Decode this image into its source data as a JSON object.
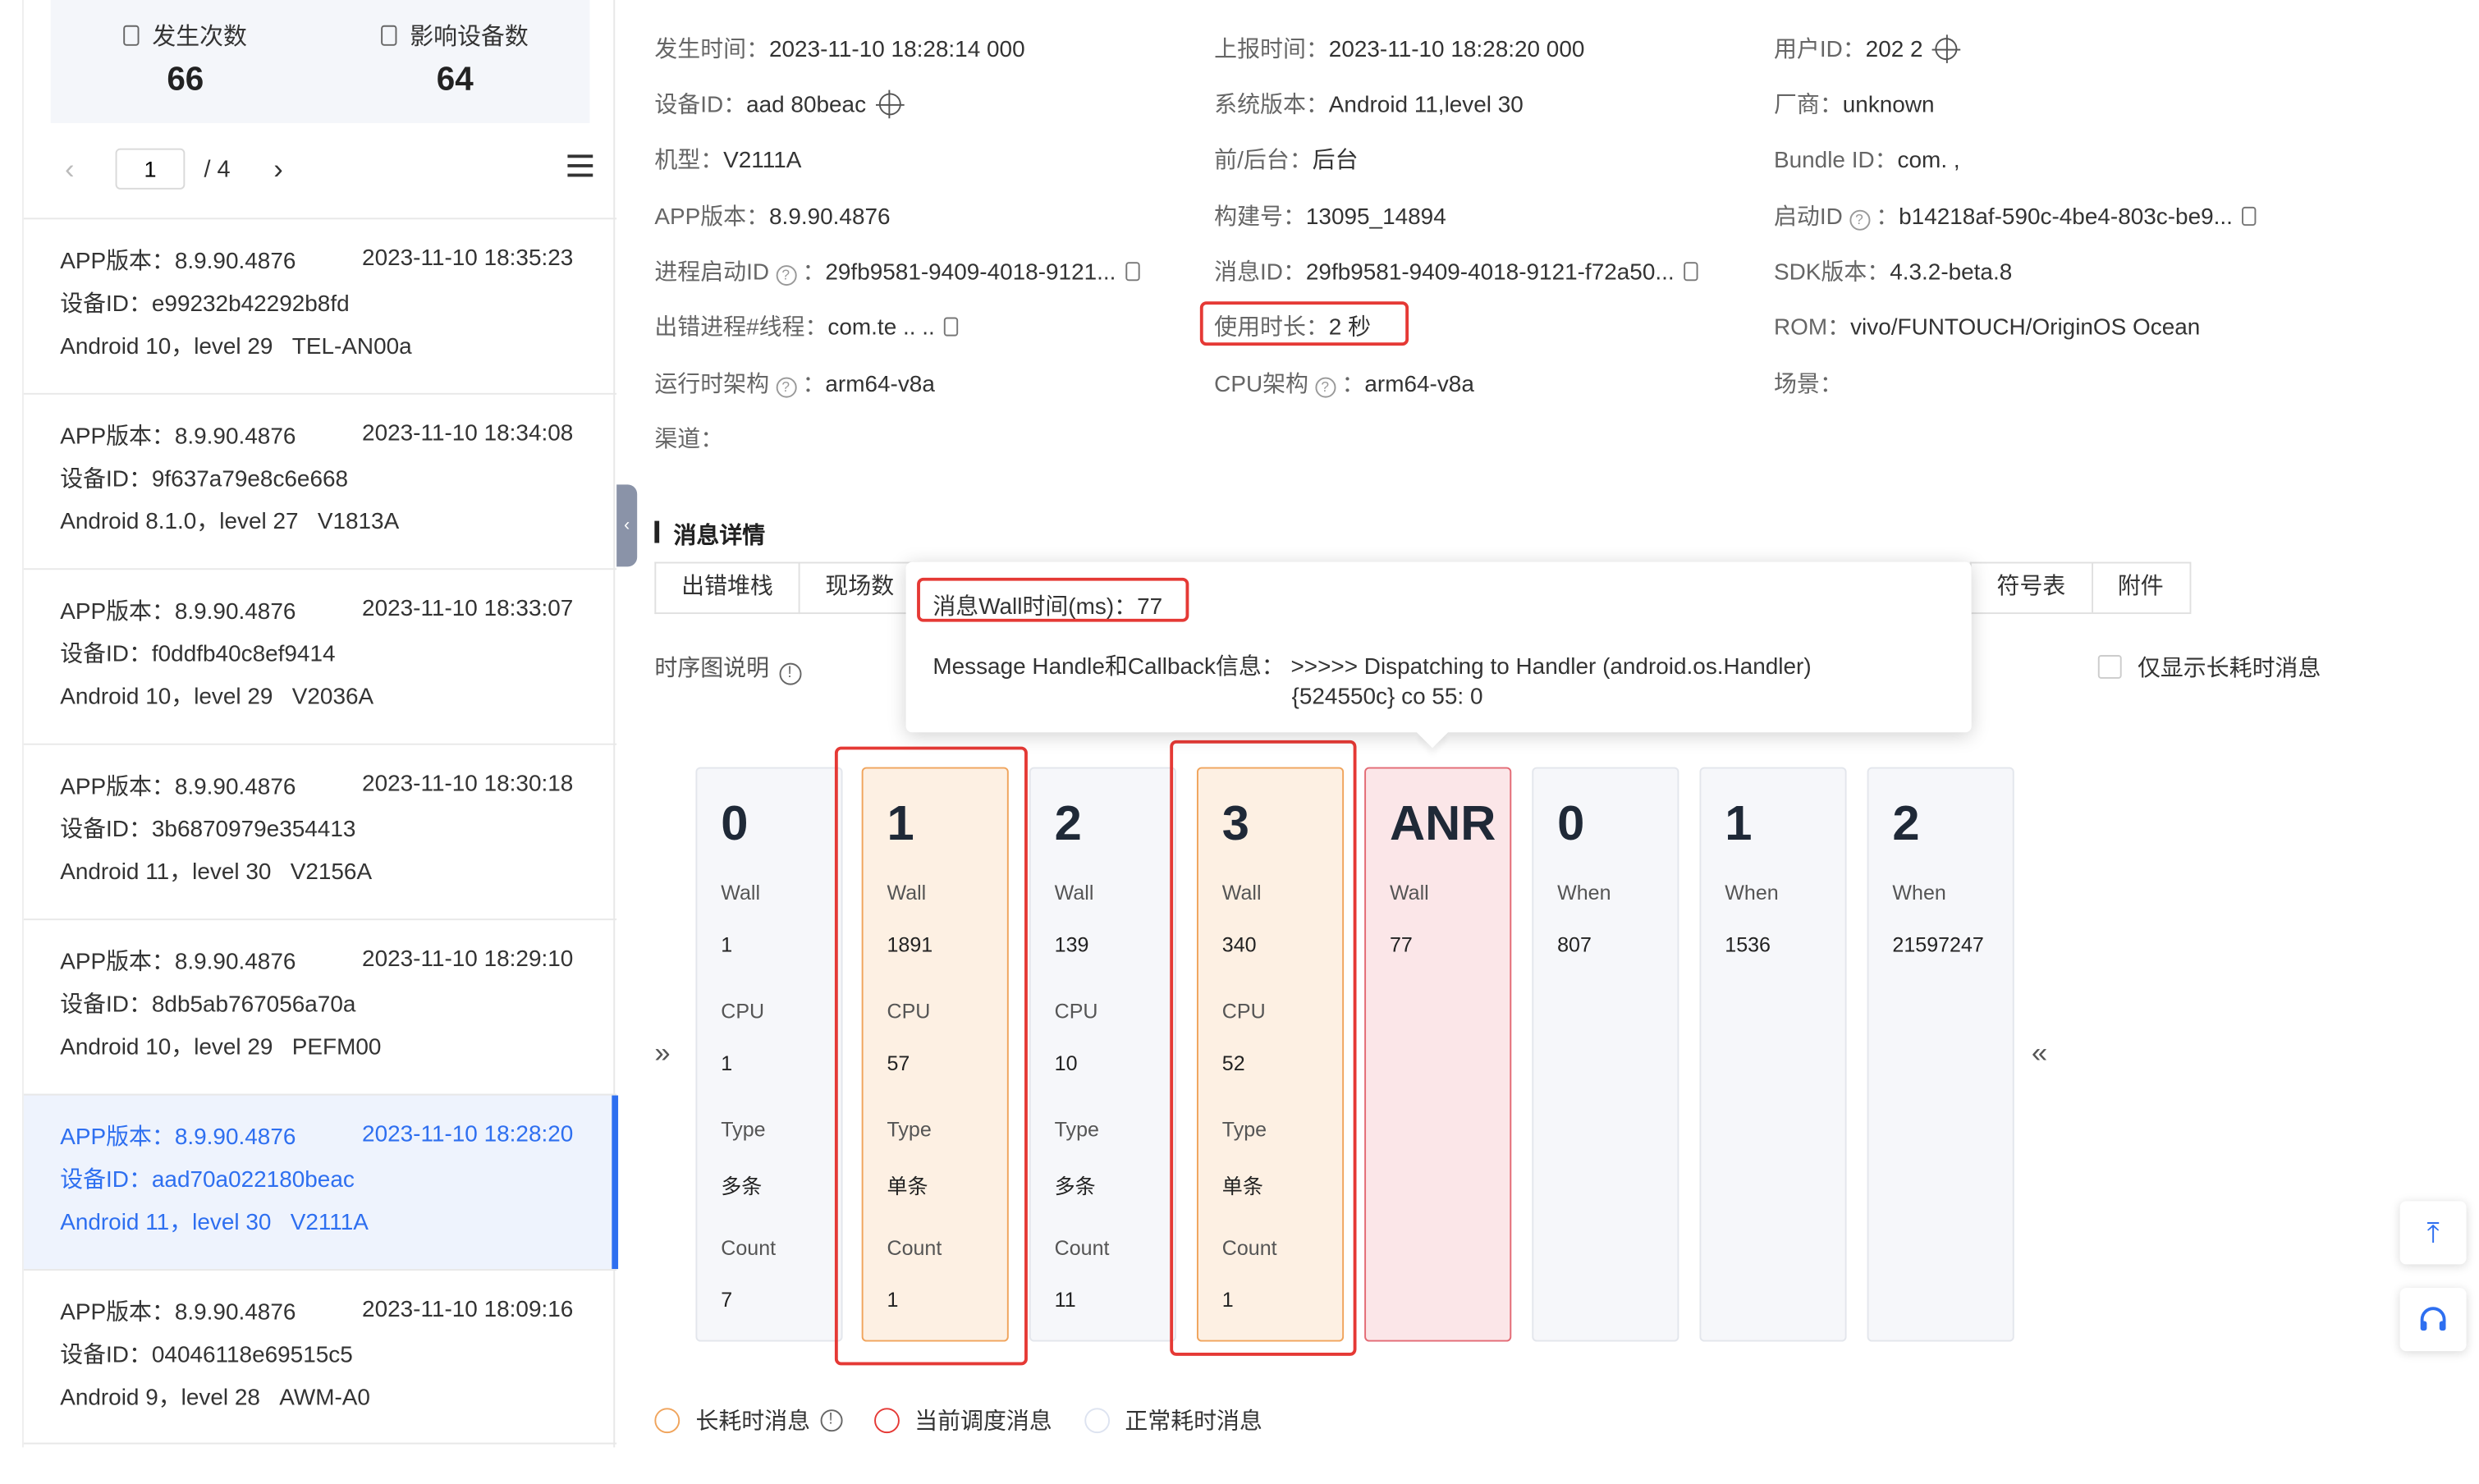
{
  "stats": {
    "occurrences_label": "发生次数",
    "occurrences_value": "66",
    "devices_label": "影响设备数",
    "devices_value": "64"
  },
  "pager": {
    "prev": "‹",
    "current": "1",
    "total": "/ 4",
    "next": "›"
  },
  "list": [
    {
      "app": "APP版本：8.9.90.4876",
      "time": "2023-11-10 18:35:23",
      "device": "设备ID：e99232b42292b8fd",
      "os": "Android 10，level 29",
      "model": "TEL-AN00a"
    },
    {
      "app": "APP版本：8.9.90.4876",
      "time": "2023-11-10 18:34:08",
      "device": "设备ID：9f637a79e8c6e668",
      "os": "Android 8.1.0，level 27",
      "model": "V1813A"
    },
    {
      "app": "APP版本：8.9.90.4876",
      "time": "2023-11-10 18:33:07",
      "device": "设备ID：f0ddfb40c8ef9414",
      "os": "Android 10，level 29",
      "model": "V2036A"
    },
    {
      "app": "APP版本：8.9.90.4876",
      "time": "2023-11-10 18:30:18",
      "device": "设备ID：3b6870979e354413",
      "os": "Android 11，level 30",
      "model": "V2156A"
    },
    {
      "app": "APP版本：8.9.90.4876",
      "time": "2023-11-10 18:29:10",
      "device": "设备ID：8db5ab767056a70a",
      "os": "Android 10，level 29",
      "model": "PEFM00"
    },
    {
      "app": "APP版本：8.9.90.4876",
      "time": "2023-11-10 18:28:20",
      "device": "设备ID：aad70a022180beac",
      "os": "Android 11，level 30",
      "model": "V2111A"
    },
    {
      "app": "APP版本：8.9.90.4876",
      "time": "2023-11-10 18:09:16",
      "device": "设备ID：04046118e69515c5",
      "os": "Android 9，level 28",
      "model": "AWM-A0"
    }
  ],
  "info": {
    "occur_time_k": "发生时间：",
    "occur_time_v": "2023-11-10 18:28:14 000",
    "report_time_k": "上报时间：",
    "report_time_v": "2023-11-10 18:28:20 000",
    "user_id_k": "用户ID：",
    "user_id_v": "202 2",
    "device_id_k": "设备ID：",
    "device_id_v": "aad 80beac",
    "sys_ver_k": "系统版本：",
    "sys_ver_v": "Android 11,level 30",
    "vendor_k": "厂商：",
    "vendor_v": "unknown",
    "model_k": "机型：",
    "model_v": "V2111A",
    "fg_k": "前/后台：",
    "fg_v": "后台",
    "bundle_k": "Bundle ID：",
    "bundle_v": "com. ,",
    "app_ver_k": "APP版本：",
    "app_ver_v": "8.9.90.4876",
    "build_k": "构建号：",
    "build_v": "13095_14894",
    "launch_k": "启动ID",
    "launch_v": "b14218af-590c-4be4-803c-be9...",
    "proc_k": "进程启动ID",
    "proc_v": "29fb9581-9409-4018-9121...",
    "msg_k": "消息ID：",
    "msg_v": "29fb9581-9409-4018-9121-f72a50...",
    "sdk_k": "SDK版本：",
    "sdk_v": "4.3.2-beta.8",
    "thread_k": "出错进程#线程：",
    "thread_v": "com.te .. ..",
    "usage_k": "使用时长：",
    "usage_v": "2 秒",
    "rom_k": "ROM：",
    "rom_v": "vivo/FUNTOUCH/OriginOS Ocean",
    "arch_k": "运行时架构",
    "arch_v": "arm64-v8a",
    "cpu_k": "CPU架构",
    "cpu_v": "arm64-v8a",
    "scene_k": "场景：",
    "channel_k": "渠道："
  },
  "section_title": "消息详情",
  "tabs_left": [
    "出错堆栈",
    "现场数"
  ],
  "tabs_right": [
    "符号表",
    "附件"
  ],
  "seq_desc": "时序图说明",
  "long_only": "仅显示长耗时消息",
  "popover": {
    "wall": "消息Wall时间(ms)：77",
    "line1": "Message Handle和Callback信息：  >>>>> Dispatching to Handler (android.os.Handler)",
    "line2": "{524550c} co 55: 0"
  },
  "arrows": {
    "left": "»",
    "right": "«"
  },
  "cards": [
    {
      "num": "0",
      "l1": "Wall",
      "v1": "1",
      "l2": "CPU",
      "v2": "1",
      "l3": "Type",
      "v3": "多条",
      "l4": "Count",
      "v4": "7",
      "kind": "normal"
    },
    {
      "num": "1",
      "l1": "Wall",
      "v1": "1891",
      "l2": "CPU",
      "v2": "57",
      "l3": "Type",
      "v3": "单条",
      "l4": "Count",
      "v4": "1",
      "kind": "long"
    },
    {
      "num": "2",
      "l1": "Wall",
      "v1": "139",
      "l2": "CPU",
      "v2": "10",
      "l3": "Type",
      "v3": "多条",
      "l4": "Count",
      "v4": "11",
      "kind": "normal"
    },
    {
      "num": "3",
      "l1": "Wall",
      "v1": "340",
      "l2": "CPU",
      "v2": "52",
      "l3": "Type",
      "v3": "单条",
      "l4": "Count",
      "v4": "1",
      "kind": "long"
    },
    {
      "num": "ANR",
      "l1": "Wall",
      "v1": "77",
      "kind": "anr"
    },
    {
      "num": "0",
      "l1": "When",
      "v1": "807",
      "kind": "normal"
    },
    {
      "num": "1",
      "l1": "When",
      "v1": "1536",
      "kind": "normal"
    },
    {
      "num": "2",
      "l1": "When",
      "v1": "21597247",
      "kind": "normal"
    }
  ],
  "legend": {
    "long": "长耗时消息",
    "current": "当前调度消息",
    "normal": "正常耗时消息"
  },
  "colors": {
    "accent": "#2e6ff0",
    "long": "#f0a45c",
    "anr": "#e36a74",
    "highlight": "#e53935"
  },
  "side_buttons": {
    "top": "⤒",
    "support": "headset-icon"
  }
}
